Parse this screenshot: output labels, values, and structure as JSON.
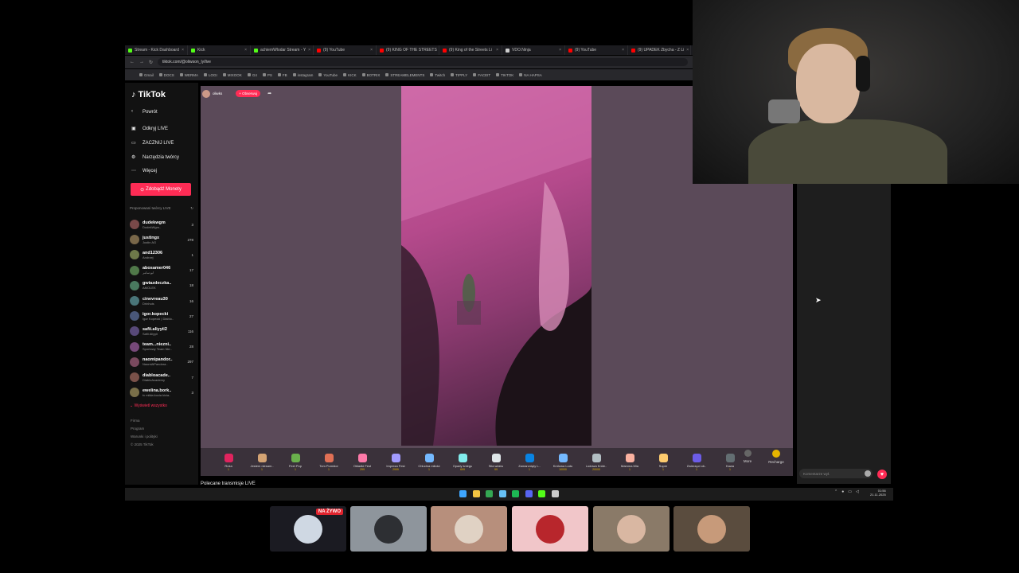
{
  "browser": {
    "tabs": [
      {
        "label": "Stream - Kick Dashboard",
        "color": "#53fc18"
      },
      {
        "label": "Kick",
        "color": "#53fc18"
      },
      {
        "label": "achiemWlodar Stream - Y",
        "color": "#53fc18"
      },
      {
        "label": "(9) YouTube",
        "color": "#ff0000"
      },
      {
        "label": "(9) KING OF THE STREETS",
        "color": "#ff0000"
      },
      {
        "label": "(9) King of the Streets Li",
        "color": "#ff0000"
      },
      {
        "label": "VDO.Ninja",
        "color": "#cccccc"
      },
      {
        "label": "(9) YouTube",
        "color": "#ff0000"
      },
      {
        "label": "(9) UPADEK Zbycha - Z Li",
        "color": "#ff0000"
      }
    ],
    "url": "tiktok.com/@oliwson_ly/live",
    "bookmarks": [
      "Gmail",
      "DOCS",
      "WERMA",
      "LOGI",
      "MIXOOK",
      "G4",
      "PS",
      "FB",
      "instagram",
      "YouTube",
      "KICK",
      "BOTRIX",
      "STREAMELEMENTS",
      "Twitch",
      "TIPPLY",
      "FACEIT",
      "TIKTOK",
      "NA HAPSA"
    ]
  },
  "tiktok": {
    "logo": "TikTok",
    "nav": [
      {
        "label": "Powrót",
        "icon": "back-arrow-icon"
      },
      {
        "label": "Odkryj LIVE",
        "icon": "live-icon"
      },
      {
        "label": "ZACZNIJ LIVE",
        "icon": "camera-icon"
      },
      {
        "label": "Narzędzia twórcy",
        "icon": "tools-icon"
      },
      {
        "label": "Więcej",
        "icon": "more-icon"
      }
    ],
    "coins_button": "Zdobądź Monety",
    "suggested_header": "Proponowani twórcy LIVE",
    "creators": [
      {
        "name": "dudekwgm",
        "sub": "DudekWgm..",
        "count": "3"
      },
      {
        "name": "justingx",
        "sub": "Justin AG",
        "count": "278"
      },
      {
        "name": "and12306",
        "sub": "Andrzej",
        "count": "1"
      },
      {
        "name": "abosamer046",
        "sub": "ابو سامر",
        "count": "17"
      },
      {
        "name": "gwiazdeczka..",
        "sub": "AMOLEK",
        "count": "18"
      },
      {
        "name": "cinevreau30",
        "sub": "Drinhuis",
        "count": "16"
      },
      {
        "name": "igor.kopecki",
        "sub": "Igor Kopecki | Diablo..",
        "count": "27"
      },
      {
        "name": "safii.aliyyii2",
        "sub": "Safii Aliyyii",
        "count": "116"
      },
      {
        "name": "team...niezni..",
        "sub": "Sportowy Team Nie..",
        "count": "28"
      },
      {
        "name": "naomipandor..",
        "sub": "NaomiAPandora..",
        "count": "297"
      },
      {
        "name": "diabloacade..",
        "sub": "DiabloAcademy",
        "count": "7"
      },
      {
        "name": "ewelina.bork..",
        "sub": "tv mikła kocia kicia..",
        "count": "3"
      }
    ],
    "show_all": "Wyświetl wszystko",
    "footer": [
      "Firma",
      "Program",
      "Warunki i polityki",
      "© 2025 TikTok"
    ],
    "host_name": "oliwks",
    "follow_label": "+ Obserwuj",
    "gifts": [
      {
        "name": "Róża",
        "price": "1",
        "color": "#e0245e"
      },
      {
        "name": "Jestem niesam..",
        "price": "1",
        "color": "#d4a373"
      },
      {
        "name": "Feel Pop",
        "price": "1",
        "color": "#6ab04c"
      },
      {
        "name": "Tom Pomidor",
        "price": "1",
        "color": "#e17055"
      },
      {
        "name": "Okładki Fest",
        "price": "299",
        "color": "#fd79a8"
      },
      {
        "name": "Impreza Fest",
        "price": "2999",
        "color": "#a29bfe"
      },
      {
        "name": "Chlodna miłość",
        "price": "1",
        "color": "#74b9ff"
      },
      {
        "name": "Opady śniegu",
        "price": "699",
        "color": "#81ecec"
      },
      {
        "name": "Siła wiatru",
        "price": "99",
        "color": "#dfe6e9"
      },
      {
        "name": "Zamarznięty L..",
        "price": "1",
        "color": "#0984e3"
      },
      {
        "name": "Królowa Lodu",
        "price": "10000",
        "color": "#74b9ff"
      },
      {
        "name": "Lodowa Króle..",
        "price": "20000",
        "color": "#b2bec3"
      },
      {
        "name": "Mamma Mia",
        "price": "1",
        "color": "#fab1a0"
      },
      {
        "name": "Super",
        "price": "1",
        "color": "#fdcb6e"
      },
      {
        "name": "Zwierzęci ob..",
        "price": "1",
        "color": "#6c5ce7"
      },
      {
        "name": "Kawa",
        "price": "1",
        "color": "#636e72"
      }
    ],
    "more_label": "More",
    "recharge_label": "Recharge",
    "recommended": "Polecane transmisje LIVE",
    "comment_placeholder": "Komentarze wył."
  },
  "taskbar": {
    "icons": [
      {
        "name": "windows-icon",
        "color": "#3ea6ff"
      },
      {
        "name": "explorer-icon",
        "color": "#f4c542"
      },
      {
        "name": "chrome-icon",
        "color": "#34a853"
      },
      {
        "name": "steam-icon",
        "color": "#66c0f4"
      },
      {
        "name": "spotify-icon",
        "color": "#1db954"
      },
      {
        "name": "discord-icon",
        "color": "#5865f2"
      },
      {
        "name": "kick-icon",
        "color": "#53fc18"
      },
      {
        "name": "obs-icon",
        "color": "#cccccc"
      }
    ],
    "time": "01:56",
    "date": "21.11.2025"
  },
  "thumbnails": [
    {
      "name": "live-thumbnail",
      "bg": "#1b1b22",
      "obj": "#cfd8e3"
    },
    {
      "name": "car-thumbnail",
      "bg": "#8e959c",
      "obj": "#2d2f33"
    },
    {
      "name": "food-thumbnail",
      "bg": "#b78f7c",
      "obj": "#e0d2c4"
    },
    {
      "name": "avatar-thumbnail",
      "bg": "#f1c6c9",
      "obj": "#b8262c"
    },
    {
      "name": "face-thumbnail",
      "bg": "#8a7a68",
      "obj": "#d9b7a2"
    },
    {
      "name": "people-thumbnail",
      "bg": "#5a4c3e",
      "obj": "#c79a7a"
    }
  ],
  "live_badge": "NA ŻYWO"
}
